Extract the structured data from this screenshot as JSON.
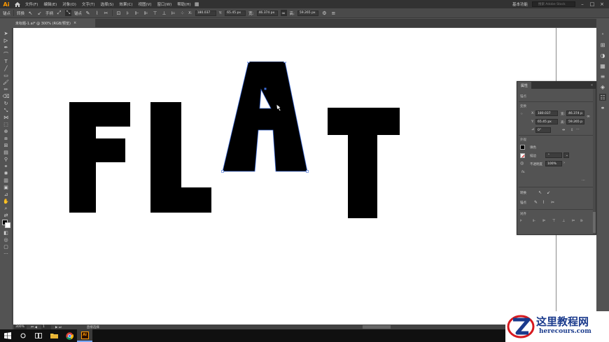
{
  "app": {
    "logo": "Ai",
    "menu": [
      "文件(F)",
      "编辑(E)",
      "对象(O)",
      "文字(T)",
      "选择(S)",
      "效果(C)",
      "视图(V)",
      "窗口(W)",
      "帮助(H)"
    ],
    "workspace": "基本功能",
    "search_placeholder": "搜索 Adobe Stock"
  },
  "control_bar": {
    "anchor_label": "锚点",
    "convert_label": "转换",
    "handle_label": "手柄",
    "anchor_label_2": "锚点",
    "x_value": "180.037",
    "y_value": "65.45 px",
    "w_value": "46.374 px",
    "h_value": "59.265 px"
  },
  "document": {
    "tab_title": "未标题-1.ai* @ 300% (RGB/预览)",
    "tab_close": "×"
  },
  "properties_panel": {
    "tab": "属性",
    "close": "«",
    "section_anchor": "锚点",
    "section_transform": "变换",
    "x_label": "X:",
    "x_value": "180.037",
    "y_label": "Y:",
    "y_value": "65.45 px",
    "w_label": "宽:",
    "w_value": "46.374 p",
    "h_label": "高:",
    "h_value": "59.265 p",
    "angle_value": "0°",
    "section_appearance": "外观",
    "fill_label": "填色",
    "stroke_label": "描边",
    "opacity_label": "不透明度",
    "opacity_value": "100%",
    "fx_label": "fx.",
    "convert_label": "转换",
    "anchor_label": "锚点",
    "align_label": "对齐"
  },
  "status_bar": {
    "zoom": "300%",
    "page": "1",
    "tool_name": "直接选择"
  },
  "watermark": {
    "title": "这里教程网",
    "url": "herecours.com"
  },
  "colors": {
    "accent": "#ff9a00",
    "selection": "#3d6bd8",
    "watermark_blue": "#1a3a8c",
    "watermark_red": "#d7191f"
  }
}
